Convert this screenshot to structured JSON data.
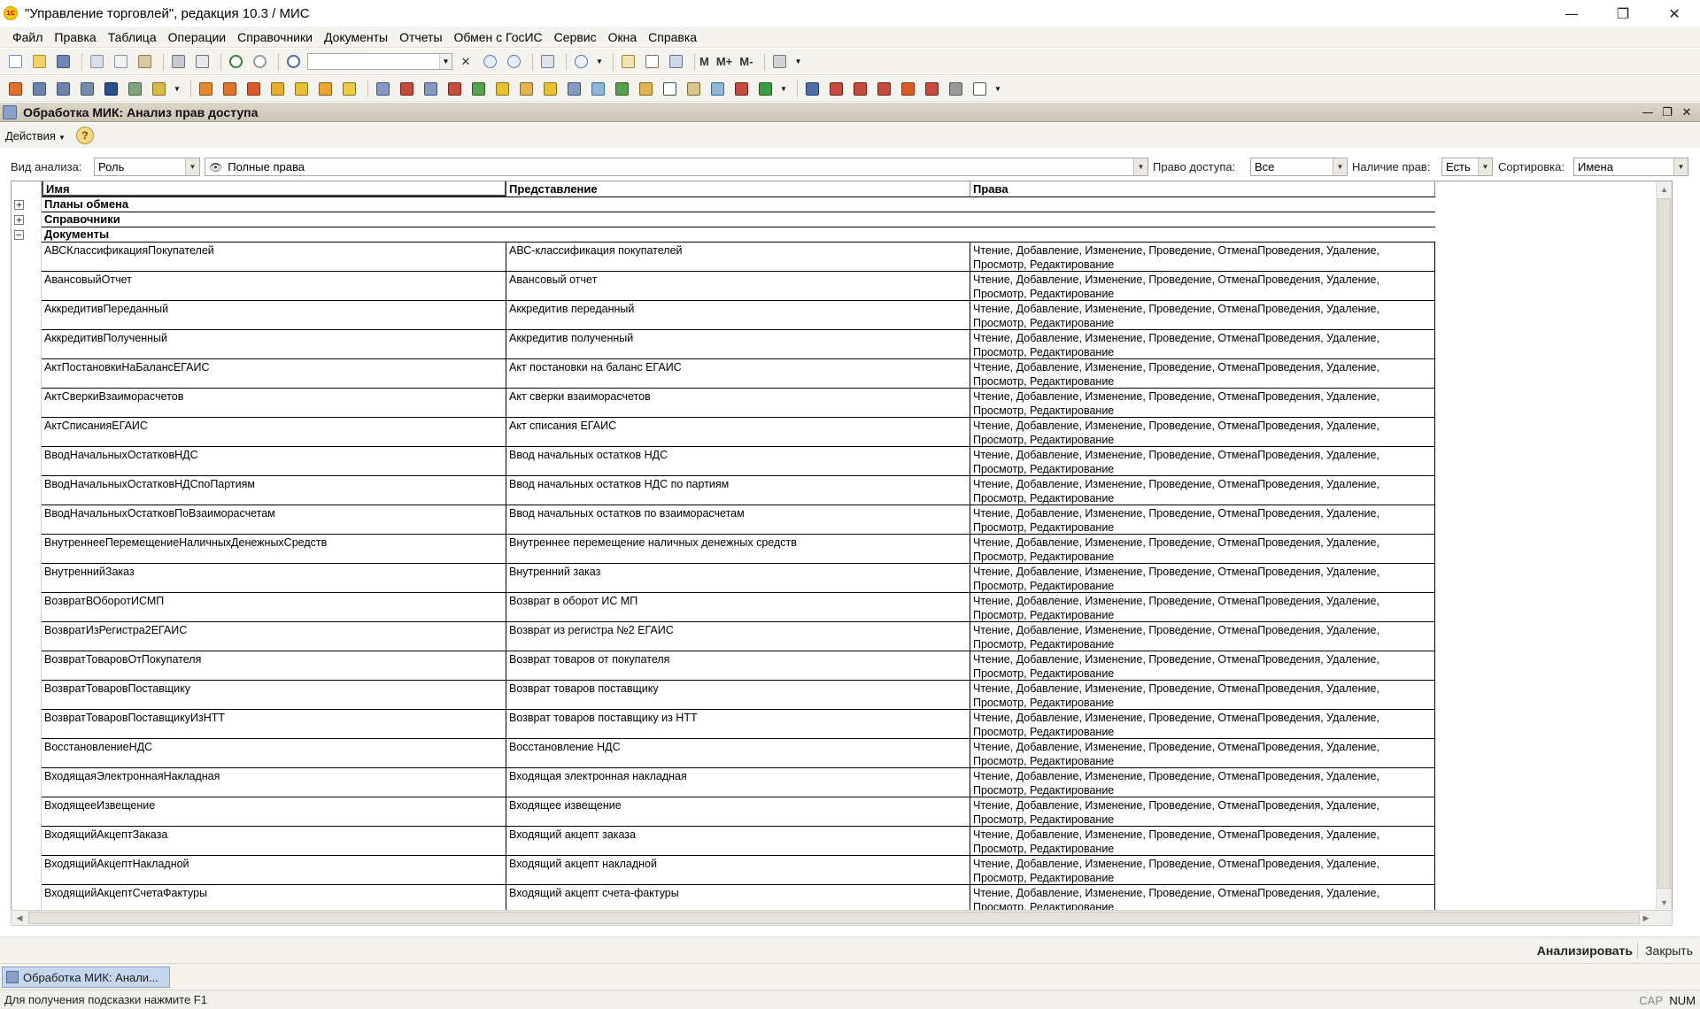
{
  "window": {
    "title": "\"Управление торговлей\", редакция 10.3 / МИС",
    "logo": "1С",
    "controls": [
      "—",
      "❐",
      "✕"
    ]
  },
  "menu": [
    "Файл",
    "Правка",
    "Таблица",
    "Операции",
    "Справочники",
    "Документы",
    "Отчеты",
    "Обмен с ГосИС",
    "Сервис",
    "Окна",
    "Справка"
  ],
  "toolbar": {
    "m_label": "M",
    "m_plus_label": "M+",
    "m_minus_label": "M-",
    "search_value": ""
  },
  "form": {
    "title": "Обработка  МИК: Анализ прав доступа",
    "actions_label": "Действия",
    "help_label": "?",
    "minimize": "—",
    "restore": "❐",
    "close": "✕"
  },
  "filters": {
    "analysis_type_label": "Вид анализа:",
    "analysis_type_value": "Роль",
    "role_value": "Полные права",
    "access_right_label": "Право доступа:",
    "access_right_value": "Все",
    "rights_presence_label": "Наличие прав:",
    "rights_presence_value": "Есть",
    "sort_label": "Сортировка:",
    "sort_value": "Имена"
  },
  "grid": {
    "columns": [
      "Имя",
      "Представление",
      "Права"
    ],
    "groups": [
      "Планы обмена",
      "Справочники",
      "Документы"
    ],
    "rights_line1": "Чтение, Добавление, Изменение, Проведение, ОтменаПроведения, Удаление,",
    "rights_line2": "Просмотр, Редактирование",
    "rows": [
      {
        "name": "АВСКлассификацияПокупателей",
        "repr": "АВС-классификация покупателей"
      },
      {
        "name": "АвансовыйОтчет",
        "repr": "Авансовый отчет"
      },
      {
        "name": "АккредитивПереданный",
        "repr": "Аккредитив переданный"
      },
      {
        "name": "АккредитивПолученный",
        "repr": "Аккредитив полученный"
      },
      {
        "name": "АктПостановкиНаБалансЕГАИС",
        "repr": "Акт постановки на баланс ЕГАИС"
      },
      {
        "name": "АктСверкиВзаиморасчетов",
        "repr": "Акт сверки взаиморасчетов"
      },
      {
        "name": "АктСписанияЕГАИС",
        "repr": "Акт списания ЕГАИС"
      },
      {
        "name": "ВводНачальныхОстатковНДС",
        "repr": "Ввод начальных остатков НДС"
      },
      {
        "name": "ВводНачальныхОстатковНДСпоПартиям",
        "repr": "Ввод начальных остатков НДС по партиям"
      },
      {
        "name": "ВводНачальныхОстатковПоВзаиморасчетам",
        "repr": "Ввод начальных остатков по взаиморасчетам"
      },
      {
        "name": "ВнутреннееПеремещениеНаличныхДенежныхСредств",
        "repr": "Внутреннее перемещение наличных денежных средств"
      },
      {
        "name": "ВнутреннийЗаказ",
        "repr": "Внутренний заказ"
      },
      {
        "name": "ВозвратВОборотИСМП",
        "repr": "Возврат в оборот ИС МП"
      },
      {
        "name": "ВозвратИзРегистра2ЕГАИС",
        "repr": "Возврат из регистра №2 ЕГАИС"
      },
      {
        "name": "ВозвратТоваровОтПокупателя",
        "repr": "Возврат товаров от покупателя"
      },
      {
        "name": "ВозвратТоваровПоставщику",
        "repr": "Возврат товаров поставщику"
      },
      {
        "name": "ВозвратТоваровПоставщикуИзНТТ",
        "repr": "Возврат товаров поставщику из НТТ"
      },
      {
        "name": "ВосстановлениеНДС",
        "repr": "Восстановление НДС"
      },
      {
        "name": "ВходящаяЭлектроннаяНакладная",
        "repr": "Входящая электронная накладная"
      },
      {
        "name": "ВходящееИзвещение",
        "repr": "Входящее извещение"
      },
      {
        "name": "ВходящийАкцептЗаказа",
        "repr": "Входящий акцепт заказа"
      },
      {
        "name": "ВходящийАкцептНакладной",
        "repr": "Входящий акцепт накладной"
      },
      {
        "name": "ВходящийАкцептСчетаФактуры",
        "repr": "Входящий акцепт счета-фактуры"
      }
    ]
  },
  "bottom": {
    "analyze_label": "Анализировать",
    "close_label": "Закрыть"
  },
  "taskbar": {
    "item_label": "Обработка  МИК: Анали..."
  },
  "status": {
    "hint": "Для получения подсказки нажмите F1",
    "cap": "CAP",
    "num": "NUM"
  },
  "colors": {
    "chrome": "#f5f3ee",
    "form_header": "#d6d1c4",
    "task_active": "#c5d6ee"
  }
}
